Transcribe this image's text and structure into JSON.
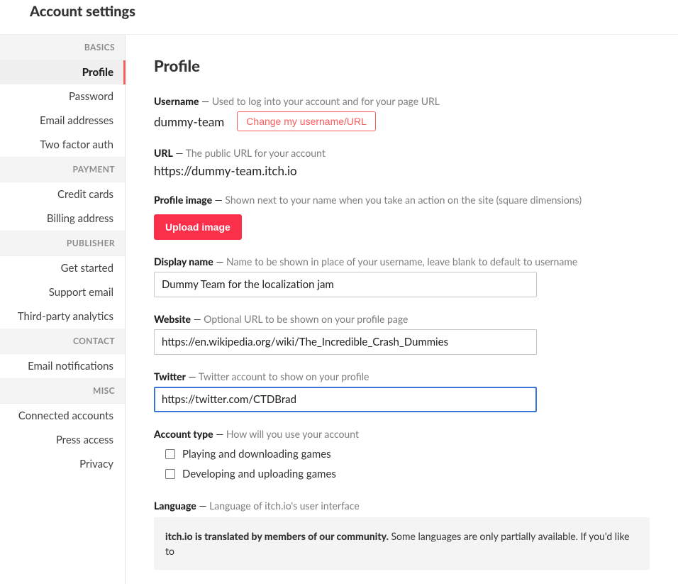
{
  "header": {
    "title": "Account settings"
  },
  "sidebar": {
    "sections": [
      {
        "label": "BASICS",
        "items": [
          "Profile",
          "Password",
          "Email addresses",
          "Two factor auth"
        ],
        "activeIndex": 0
      },
      {
        "label": "PAYMENT",
        "items": [
          "Credit cards",
          "Billing address"
        ]
      },
      {
        "label": "PUBLISHER",
        "items": [
          "Get started",
          "Support email",
          "Third-party analytics"
        ]
      },
      {
        "label": "CONTACT",
        "items": [
          "Email notifications"
        ]
      },
      {
        "label": "MISC",
        "items": [
          "Connected accounts",
          "Press access",
          "Privacy"
        ]
      }
    ]
  },
  "main": {
    "title": "Profile",
    "username": {
      "label": "Username",
      "hint": "Used to log into your account and for your page URL",
      "value": "dummy-team",
      "changeBtn": "Change my username/URL"
    },
    "url": {
      "label": "URL",
      "hint": "The public URL for your account",
      "value": "https://dummy-team.itch.io"
    },
    "profileImage": {
      "label": "Profile image",
      "hint": "Shown next to your name when you take an action on the site (square dimensions)",
      "button": "Upload image"
    },
    "displayName": {
      "label": "Display name",
      "hint": "Name to be shown in place of your username, leave blank to default to username",
      "value": "Dummy Team for the localization jam"
    },
    "website": {
      "label": "Website",
      "hint": "Optional URL to be shown on your profile page",
      "value": "https://en.wikipedia.org/wiki/The_Incredible_Crash_Dummies"
    },
    "twitter": {
      "label": "Twitter",
      "hint": "Twitter account to show on your profile",
      "value": "https://twitter.com/CTDBrad"
    },
    "accountType": {
      "label": "Account type",
      "hint": "How will you use your account",
      "options": [
        "Playing and downloading games",
        "Developing and uploading games"
      ]
    },
    "language": {
      "label": "Language",
      "hint": "Language of itch.io's user interface",
      "noteStrong": "itch.io is translated by members of our community.",
      "noteRest": " Some languages are only partially available. If you'd like to"
    }
  }
}
